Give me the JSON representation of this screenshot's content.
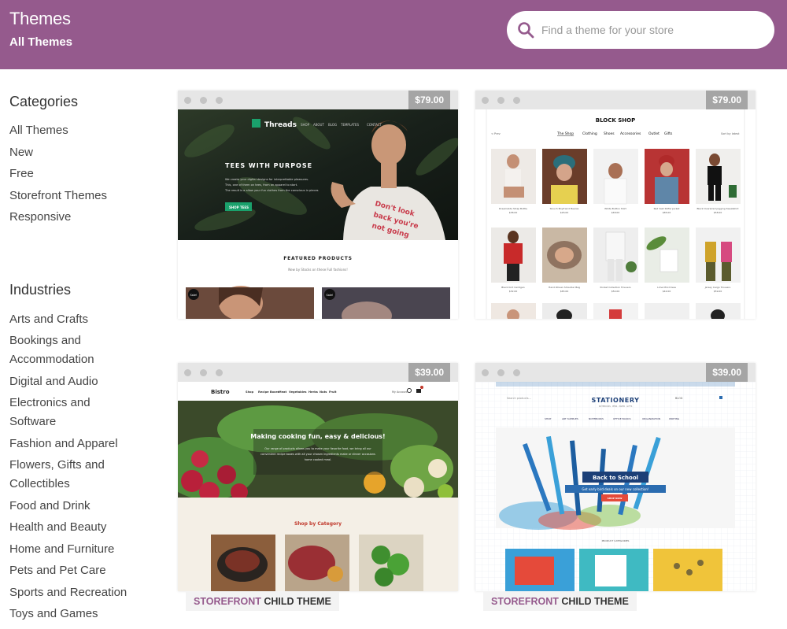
{
  "header": {
    "title": "Themes",
    "subtitle": "All Themes",
    "search_placeholder": "Find a theme for your store"
  },
  "sidebar": {
    "categories_title": "Categories",
    "categories": [
      "All Themes",
      "New",
      "Free",
      "Storefront Themes",
      "Responsive"
    ],
    "industries_title": "Industries",
    "industries": [
      [
        "Arts and Crafts"
      ],
      [
        "Bookings and",
        "Accommodation"
      ],
      [
        "Digital and Audio"
      ],
      [
        "Electronics and",
        "Software"
      ],
      [
        "Fashion and Apparel"
      ],
      [
        "Flowers, Gifts and",
        "Collectibles"
      ],
      [
        "Food and Drink"
      ],
      [
        "Health and Beauty"
      ],
      [
        "Home and Furniture"
      ],
      [
        "Pets and Pet Care"
      ],
      [
        "Sports and Recreation"
      ],
      [
        "Toys and Games"
      ]
    ]
  },
  "themes": [
    {
      "price": "$79.00",
      "brand": "Threads",
      "nav": [
        "SHOP",
        "ABOUT",
        "BLOG",
        "TEMPLATES",
        "CONTACT"
      ],
      "hero_title": "TEES WITH PURPOSE",
      "hero_lines": [
        "We create your digital designs for interprettable pleasures.",
        "This, one of them on tees, from an apparel to start.",
        "The result is a allow your fun clothes from the conscious in pieces"
      ],
      "hero_button": "SHOP TEES",
      "tee_text": "Don't look back you're not going that way",
      "section_title": "FEATURED PRODUCTS",
      "section_sub": "New by Stocks on these Full fashions!",
      "sale_badge": "Sale!"
    },
    {
      "price": "$79.00",
      "brand": "BLOCK SHOP",
      "nav": [
        "The Shop",
        "Clothing",
        "Shoes",
        "Accessories",
        "Outlet",
        "Gifts"
      ],
      "left_link": "< Prev",
      "right_link": "Sort by latest",
      "products_row1": [
        {
          "name": "Dreamslide Strap Bottle",
          "price": "$38.00"
        },
        {
          "name": "Slouch Boyfriend Beanie",
          "price": "$26.00"
        },
        {
          "name": "White Button Shirt",
          "price": "$48.00"
        },
        {
          "name": "Red Vest Puffer Jacket",
          "price": "$85.00"
        },
        {
          "name": "Black Oversized Jogging Sweatshirt",
          "price": "$58.00"
        }
      ],
      "products_row2": [
        {
          "name": "Black Knit Cardigan",
          "price": "$32.00"
        },
        {
          "name": "Hand Woven Shoulder Bag",
          "price": "$65.00"
        },
        {
          "name": "Pocket Collection Trousers",
          "price": "$54.00"
        },
        {
          "name": "Lime Mini Dress",
          "price": "$42.00"
        },
        {
          "name": "Jersey Cargo Trousers",
          "price": "$59.00"
        }
      ]
    },
    {
      "price": "$39.00",
      "brand": "Bistro",
      "nav": [
        "Shop",
        "Recipe Boxes",
        "Meat",
        "Vegetables",
        "Herbs",
        "Nuts",
        "Fruit"
      ],
      "account": "My Account",
      "hero_title": "Making cooking fun, easy & delicious!",
      "hero_lines": [
        "Our range of products allows you to make your favorite food, we bring all our",
        "convenient recipe boxes with all your chosen ingredients make or dinner occasions",
        "home cooked meal."
      ],
      "section_title": "Shop by Category",
      "label_accent": "STOREFRONT",
      "label_rest": " CHILD THEME"
    },
    {
      "price": "$39.00",
      "brand": "STATIONERY",
      "tagline": "NOTEBOOKS · PENS · PAPER · GIFTS",
      "search_hint": "Search products...",
      "nav": [
        "SHOP",
        "ART SUPPLIES",
        "NOTEBOOKS",
        "OFFICE BASICS",
        "ORGANIZATION",
        "WRITING"
      ],
      "account": "BLOG",
      "hero_title": "Back to School",
      "hero_sub": "Get early bird deals on our new collection!",
      "hero_button": "SHOP NOW",
      "section_title": "PRODUCT CATEGORIES",
      "label_accent": "STOREFRONT",
      "label_rest": " CHILD THEME"
    }
  ],
  "colors": {
    "header_bg": "#955a8d",
    "accent": "#955a8d",
    "price_bg": "#a5a5a5",
    "bar_bg": "#e6e6e6",
    "threads_green": "#1aa16c",
    "bistro_red": "#c0382b",
    "stationery_blue": "#2b6cb0"
  }
}
